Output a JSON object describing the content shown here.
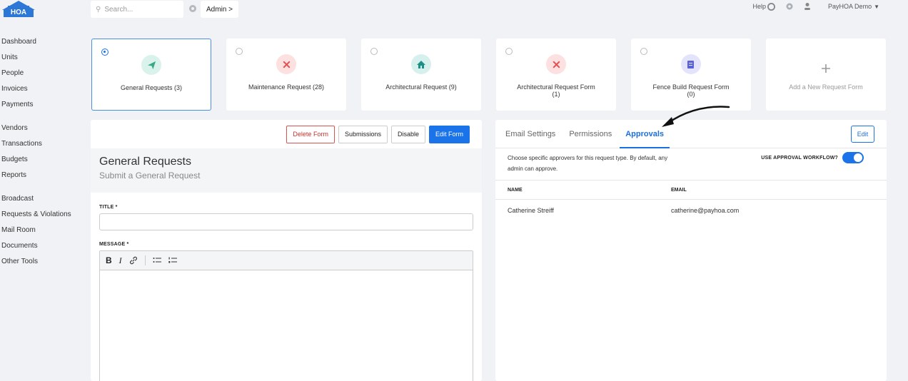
{
  "logo": {
    "text": "HOA",
    "icon": "house-logo"
  },
  "topbar": {
    "search_placeholder": "Search...",
    "admin_label": "Admin >",
    "help_label": "Help",
    "user_label": "PayHOA Demo"
  },
  "sidebar": {
    "groups": [
      [
        "Dashboard",
        "Units",
        "People",
        "Invoices",
        "Payments"
      ],
      [
        "Vendors",
        "Transactions",
        "Budgets",
        "Reports"
      ],
      [
        "Broadcast",
        "Requests & Violations",
        "Mail Room",
        "Documents",
        "Other Tools"
      ]
    ]
  },
  "cards": [
    {
      "label": "General Requests (3)",
      "selected": true,
      "icon": "paper-plane-icon",
      "bg": "#d9f2ec",
      "fg": "#3aa786"
    },
    {
      "label": "Maintenance Request (28)",
      "selected": false,
      "icon": "tools-icon",
      "bg": "#fde0e0",
      "fg": "#e35252"
    },
    {
      "label": "Architectural Request (9)",
      "selected": false,
      "icon": "house-icon",
      "bg": "#d6f0ee",
      "fg": "#1f8e86"
    },
    {
      "label": "Architectural Request Form\n(1)",
      "selected": false,
      "icon": "tools-icon",
      "bg": "#fde0e0",
      "fg": "#e35252"
    },
    {
      "label": "Fence Build Request Form\n(0)",
      "selected": false,
      "icon": "form-icon",
      "bg": "#e3e4fb",
      "fg": "#5a61d6"
    },
    {
      "label": "Add a New Request Form",
      "add": true,
      "icon": "plus-icon"
    }
  ],
  "form_panel": {
    "buttons": {
      "delete": "Delete Form",
      "submissions": "Submissions",
      "disable": "Disable",
      "edit": "Edit Form"
    },
    "title": "General Requests",
    "subtitle": "Submit a General Request",
    "title_label": "TITLE *",
    "message_label": "MESSAGE *",
    "editor_tools": {
      "bold": "B",
      "italic": "I"
    }
  },
  "settings_panel": {
    "tabs": [
      "Email Settings",
      "Permissions",
      "Approvals"
    ],
    "active_tab": "Approvals",
    "edit_label": "Edit",
    "description": "Choose specific approvers for this request type. By default, any admin can approve.",
    "workflow_label": "USE APPROVAL WORKFLOW?",
    "workflow_on": true,
    "columns": {
      "name": "NAME",
      "email": "EMAIL"
    },
    "approvers": [
      {
        "name": "Catherine Streiff",
        "email": "catherine@payhoa.com"
      }
    ]
  }
}
